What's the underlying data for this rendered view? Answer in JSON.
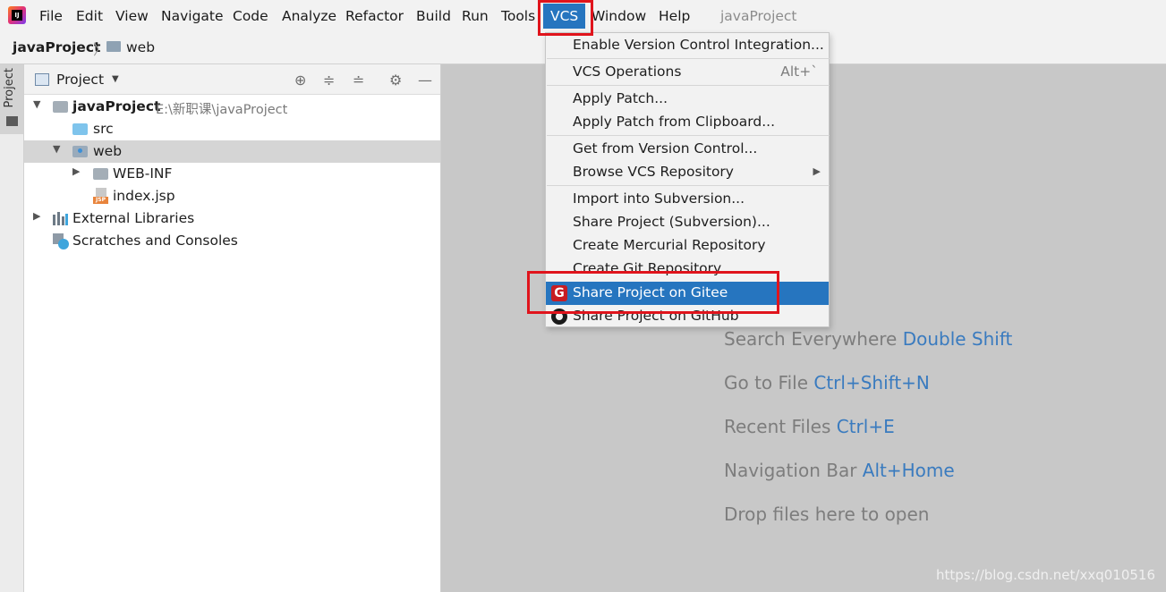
{
  "menubar": {
    "items": [
      "File",
      "Edit",
      "View",
      "Navigate",
      "Code",
      "Analyze",
      "Refactor",
      "Build",
      "Run",
      "Tools",
      "VCS",
      "Window",
      "Help"
    ],
    "project_title": "javaProject"
  },
  "breadcrumb": {
    "root": "javaProject",
    "folder": "web"
  },
  "toolstrip": {
    "project_tab": "Project"
  },
  "panel": {
    "title": "Project",
    "tree": {
      "root_label": "javaProject",
      "root_path": "E:\\新职课\\javaProject",
      "src": "src",
      "web": "web",
      "webinf": "WEB-INF",
      "index": "index.jsp",
      "libs": "External Libraries",
      "scratches": "Scratches and Consoles"
    }
  },
  "vcs_menu": {
    "items": [
      "Enable Version Control Integration...",
      "VCS Operations",
      "Apply Patch...",
      "Apply Patch from Clipboard...",
      "Get from Version Control...",
      "Browse VCS Repository",
      "Import into Subversion...",
      "Share Project (Subversion)...",
      "Create Mercurial Repository",
      "Create Git Repository...",
      "Share Project on Gitee",
      "Share Project on GitHub"
    ],
    "ops_shortcut": "Alt+`",
    "highlighted_item": "Share Project on Gitee"
  },
  "editor": {
    "hints": [
      {
        "text": "Search Everywhere",
        "key": "Double Shift"
      },
      {
        "text": "Go to File",
        "key": "Ctrl+Shift+N"
      },
      {
        "text": "Recent Files",
        "key": "Ctrl+E"
      },
      {
        "text": "Navigation Bar",
        "key": "Alt+Home"
      },
      {
        "text": "Drop files here to open",
        "key": ""
      }
    ],
    "watermark": "https://blog.csdn.net/xxq010516"
  },
  "colors": {
    "accent": "#2675bf",
    "annotation_red": "#e0141c",
    "gitee": "#c71d23"
  }
}
